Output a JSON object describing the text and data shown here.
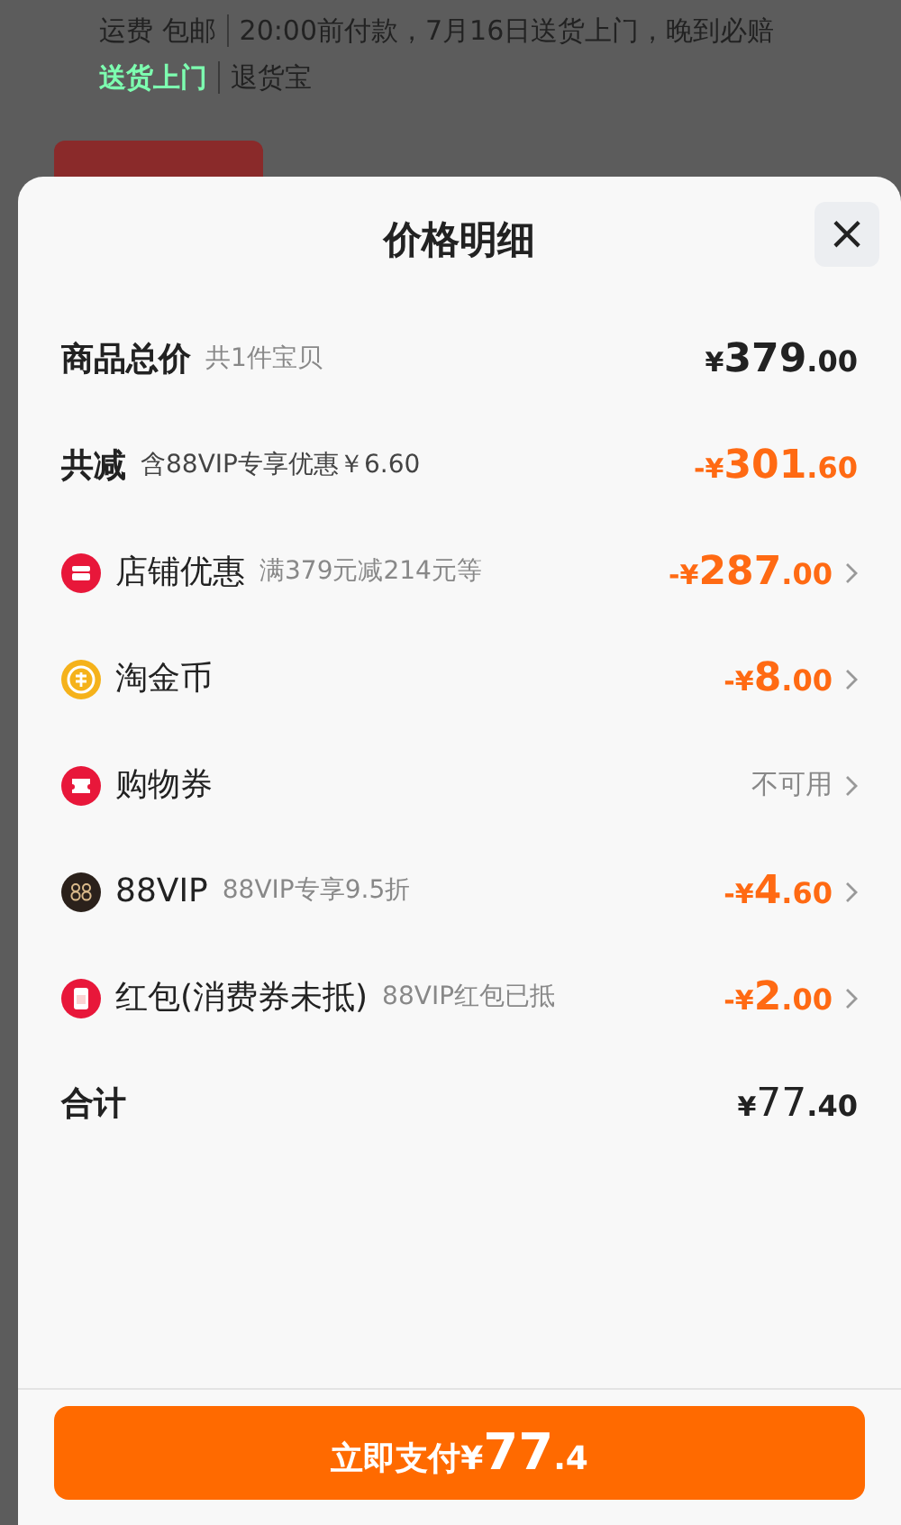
{
  "background": {
    "shipping_label": "运费",
    "shipping_value": "包邮",
    "delivery_note": "20:00前付款，7月16日送货上门，晚到必赔",
    "tags": [
      {
        "label": "送货上门",
        "highlight": true
      },
      {
        "label": "退货宝",
        "highlight": false
      }
    ]
  },
  "sheet": {
    "title": "价格明细",
    "close": "×",
    "rows": [
      {
        "kind": "plain",
        "label": "商品总价",
        "note": "共1件宝贝",
        "amount": {
          "prefix": "¥",
          "main": "379",
          "decimal": ".00"
        },
        "discount": false,
        "chevron": false
      },
      {
        "kind": "plain",
        "label": "共减",
        "note": "含88VIP专享优惠￥6.60",
        "note_dark": true,
        "amount": {
          "prefix": "-¥",
          "main": "301",
          "decimal": ".60"
        },
        "discount": true,
        "chevron": false
      },
      {
        "kind": "shop",
        "label": "店铺优惠",
        "note": "满379元减214元等",
        "amount": {
          "prefix": "-¥",
          "main": "287",
          "decimal": ".00"
        },
        "discount": true,
        "chevron": true
      },
      {
        "kind": "coin",
        "label": "淘金币",
        "amount": {
          "prefix": "-¥",
          "main": "8",
          "decimal": ".00"
        },
        "discount": true,
        "chevron": true
      },
      {
        "kind": "coupon",
        "label": "购物券",
        "status": "不可用",
        "chevron": true
      },
      {
        "kind": "vip",
        "label": "88VIP",
        "note": "88VIP专享9.5折",
        "amount": {
          "prefix": "-¥",
          "main": "4",
          "decimal": ".60"
        },
        "discount": true,
        "chevron": true
      },
      {
        "kind": "redpacket",
        "label": "红包(消费券未抵)",
        "note": "88VIP红包已抵",
        "amount": {
          "prefix": "-¥",
          "main": "2",
          "decimal": ".00"
        },
        "discount": true,
        "chevron": true
      },
      {
        "kind": "plain",
        "label": "合计",
        "amount": {
          "prefix": "¥",
          "main": "77",
          "decimal": ".40"
        },
        "discount": false,
        "chevron": false,
        "light_integer": true
      }
    ],
    "pay_button": {
      "label": "立即支付",
      "prefix": "¥",
      "main": "77",
      "decimal": ".4"
    }
  }
}
